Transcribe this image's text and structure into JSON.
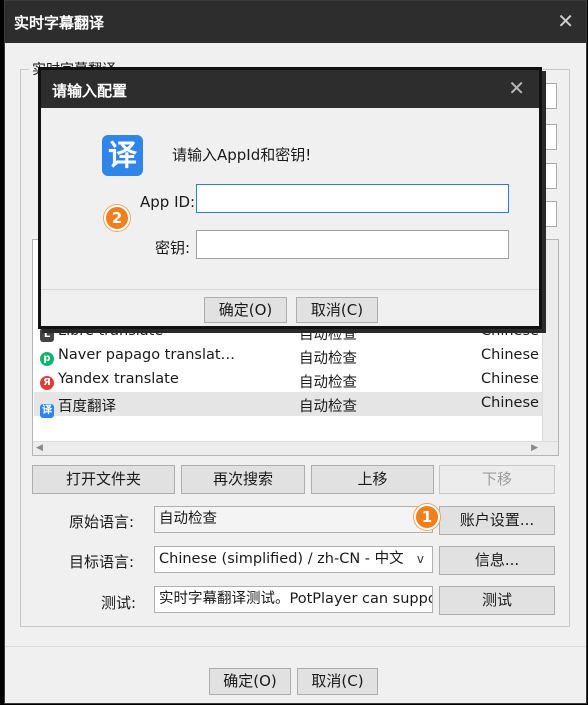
{
  "window": {
    "title": "实时字幕翻译",
    "close_glyph": "✕",
    "group_label": "实时字幕翻译"
  },
  "list": {
    "rows": [
      {
        "name": "Libre translate",
        "auto": "自动检查",
        "lang": "Chinese (s",
        "icon": "libre-translate-icon",
        "icon_color": "#444444"
      },
      {
        "name": "Naver papago translat…",
        "auto": "自动检查",
        "lang": "Chinese (s",
        "icon": "papago-icon",
        "icon_color": "#13b36f"
      },
      {
        "name": "Yandex translate",
        "auto": "自动检查",
        "lang": "Chinese (s",
        "icon": "yandex-icon",
        "icon_color": "#e53935"
      },
      {
        "name": "百度翻译",
        "auto": "自动检查",
        "lang": "Chinese (s",
        "icon": "baidu-translate-icon",
        "icon_color": "#2f86e8"
      }
    ]
  },
  "buttons": {
    "open_folder": "打开文件夹",
    "search_again": "再次搜索",
    "move_up": "上移",
    "move_down": "下移",
    "account_settings": "账户设置...",
    "info": "信息...",
    "test": "测试"
  },
  "fields": {
    "source_label": "原始语言:",
    "source_value": "自动检查",
    "target_label": "目标语言:",
    "target_value": "Chinese (simplified) / zh-CN - 中文",
    "test_label": "测试:",
    "test_value": "实时字幕翻译测试。PotPlayer can suppo"
  },
  "footer": {
    "ok": "确定(O)",
    "cancel": "取消(C)"
  },
  "badges": {
    "one": "1",
    "two": "2",
    "color": "#f07f1c"
  },
  "dialog": {
    "title": "请输入配置",
    "close_glyph": "✕",
    "app_icon_char": "译",
    "message": "请输入AppId和密钥!",
    "appid_label": "App ID:",
    "appid_value": "",
    "key_label": "密钥:",
    "key_value": "",
    "ok": "确定(O)",
    "cancel": "取消(C)"
  }
}
